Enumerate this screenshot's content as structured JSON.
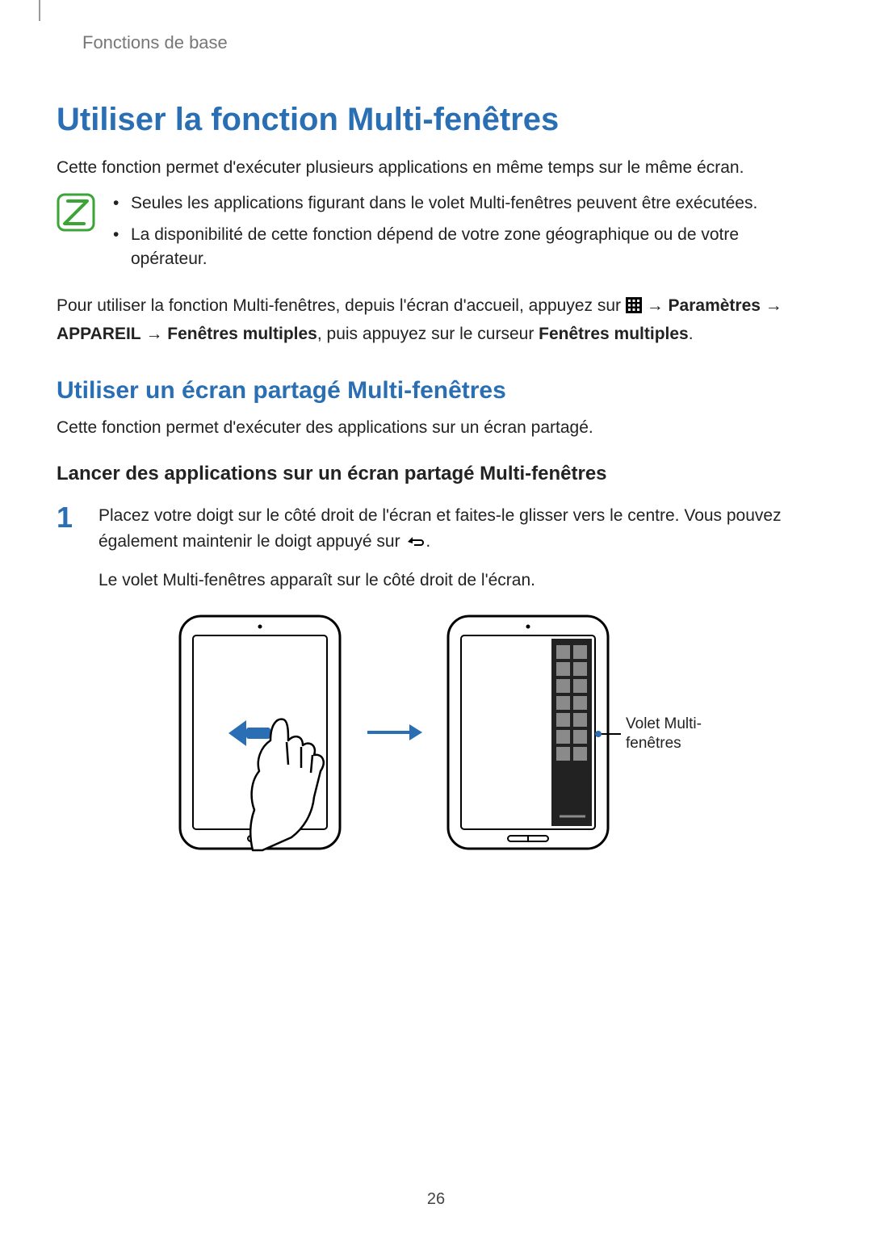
{
  "breadcrumb": "Fonctions de base",
  "title": "Utiliser la fonction Multi-fenêtres",
  "intro": "Cette fonction permet d'exécuter plusieurs applications en même temps sur le même écran.",
  "notes": [
    "Seules les applications figurant dans le volet Multi-fenêtres peuvent être exécutées.",
    "La disponibilité de cette fonction dépend de votre zone géographique ou de votre opérateur."
  ],
  "usage": {
    "pre": "Pour utiliser la fonction Multi-fenêtres, depuis l'écran d'accueil, appuyez sur ",
    "arrow": " → ",
    "params": "Paramètres",
    "appareil": "APPAREIL",
    "fen": "Fenêtres multiples",
    "mid": ", puis appuyez sur le curseur ",
    "end": "."
  },
  "subtitle": "Utiliser un écran partagé Multi-fenêtres",
  "subtitle_desc": "Cette fonction permet d'exécuter des applications sur un écran partagé.",
  "subsub": "Lancer des applications sur un écran partagé Multi-fenêtres",
  "step1": {
    "num": "1",
    "line1a": "Placez votre doigt sur le côté droit de l'écran et faites-le glisser vers le centre. Vous pouvez également maintenir le doigt appuyé sur ",
    "line1b": ".",
    "line2": "Le volet Multi-fenêtres apparaît sur le côté droit de l'écran."
  },
  "callout": "Volet Multi-fenêtres",
  "page_number": "26"
}
